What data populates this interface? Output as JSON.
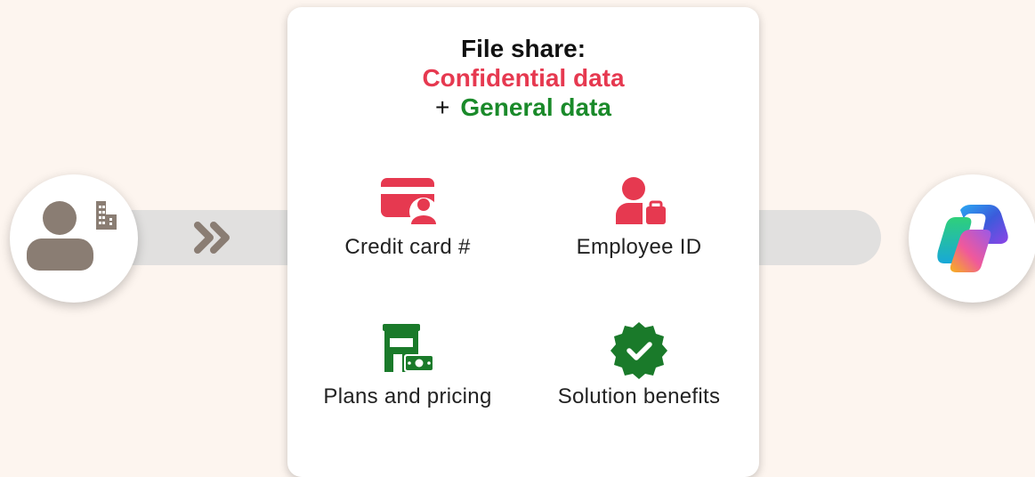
{
  "card": {
    "title": "File share:",
    "confidential": "Confidential data",
    "plus": "+",
    "general": "General data"
  },
  "items": [
    {
      "label": "Credit card #",
      "icon": "credit-card-user-icon",
      "color": "#e63950"
    },
    {
      "label": "Employee ID",
      "icon": "employee-briefcase-icon",
      "color": "#e63950"
    },
    {
      "label": "Plans and pricing",
      "icon": "store-money-icon",
      "color": "#1a7a2a"
    },
    {
      "label": "Solution benefits",
      "icon": "verified-badge-icon",
      "color": "#1a7a2a"
    }
  ],
  "colors": {
    "background": "#fdf5ef",
    "confidential": "#e63950",
    "general": "#1a8a2a",
    "track": "#e1e0df",
    "user_icon": "#8a7d73"
  },
  "icons": {
    "left": "user-building-icon",
    "arrow": "double-chevron-right-icon",
    "right": "copilot-logo-icon"
  }
}
